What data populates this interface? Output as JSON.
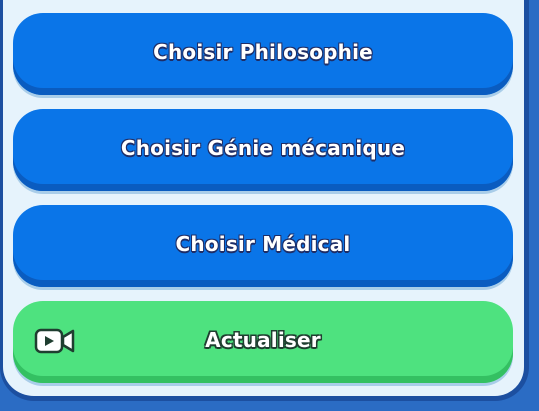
{
  "choices": [
    {
      "label": "Choisir Philosophie"
    },
    {
      "label": "Choisir Génie mécanique"
    },
    {
      "label": "Choisir Médical"
    }
  ],
  "refresh": {
    "label": "Actualiser",
    "icon": "video-camera-icon"
  },
  "colors": {
    "choice_button": "#0a75e8",
    "refresh_button": "#4ee27f",
    "panel_background": "#e6f3fc",
    "frame": "#1c4fa0"
  }
}
